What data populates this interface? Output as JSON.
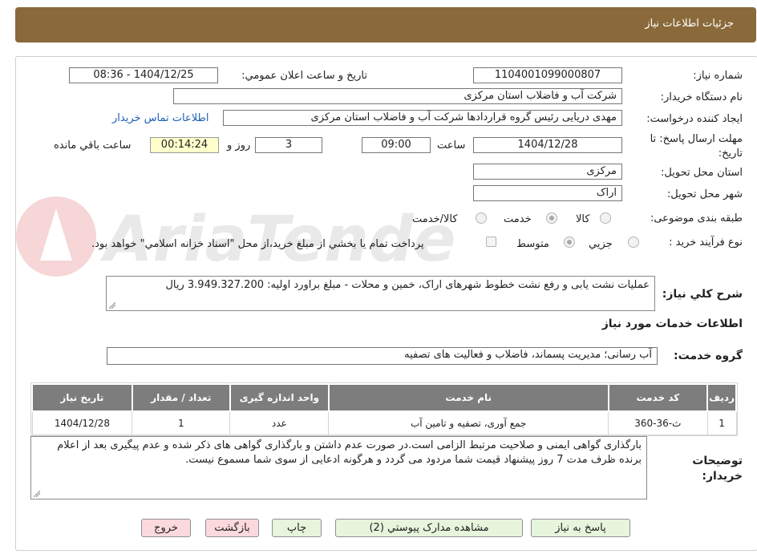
{
  "header": {
    "title": "جزئیات اطلاعات نیاز"
  },
  "form": {
    "need_number_label": "شماره نیاز:",
    "need_number": "1104001099000807",
    "announce_label": "تاریخ و ساعت اعلان عمومي:",
    "announce_value": "1404/12/25 - 08:36",
    "buyer_org_label": "نام دستگاه خريدار:",
    "buyer_org": "شرکت آب و فاضلاب استان مرکزی",
    "requester_label": "ايجاد کننده درخواست:",
    "requester": "مهدی دریایی رئیس گروه قراردادها شرکت آب و فاضلاب استان مرکزی",
    "contact_link": "اطلاعات تماس خريدار",
    "deadline_label": "مهلت ارسال پاسخ: تا تاريخ:",
    "deadline_date": "1404/12/28",
    "time_label": "ساعت",
    "deadline_time": "09:00",
    "days_value": "3",
    "days_label": "روز و",
    "remaining_time": "00:14:24",
    "remaining_label": "ساعت باقي مانده",
    "province_label": "استان محل تحويل:",
    "province": "مرکزی",
    "city_label": "شهر محل تحويل:",
    "city": "اراک",
    "category_label": "طبقه بندی موضوعی:",
    "category_options": [
      "کالا",
      "خدمت",
      "کالا/خدمت"
    ],
    "category_selected": "خدمت",
    "process_label": "نوع فرآيند خريد :",
    "process_options": [
      "جزيي",
      "متوسط"
    ],
    "process_selected": "متوسط",
    "payment_note": "پرداخت تمام يا بخشي از مبلغ خريد،از محل \"اسناد خزانه اسلامي\" خواهد بود.",
    "description_label": "شرح کلي نياز:",
    "description": "عملیات نشت یابی و رفع نشت خطوط شهرهای اراک، خمین و محلات - مبلغ براورد اولیه: 3.949.327.200 ریال"
  },
  "services": {
    "section_title": "اطلاعات خدمات مورد نياز",
    "group_label": "گروه خدمت:",
    "group_value": "آب رسانی؛ مديريت پسماند، فاضلاب و فعاليت هاى تصفيه",
    "columns": [
      "رديف",
      "کد خدمت",
      "نام خدمت",
      "واحد اندازه گيری",
      "تعداد / مقدار",
      "تاريخ نياز"
    ],
    "rows": [
      [
        "1",
        "ث-36-360",
        "جمع آوری، تصفيه و تامين آب",
        "عدد",
        "1",
        "1404/12/28"
      ]
    ]
  },
  "buyer_notes": {
    "label": "توضيحات خريدار:",
    "text": "بارگذاری گواهی ایمنی و صلاحیت مرتبط الزامی است.در صورت عدم داشتن و بارگذاری گواهی های ذکر شده و عدم پیگیری بعد از اعلام برنده ظرف مدت 7 روز پیشنهاد قیمت شما مردود می گردد و هرگونه ادعایی از سوی شما مسموع نیست."
  },
  "buttons": {
    "reply": "پاسخ به نياز",
    "attachments": "مشاهده مدارک پيوستي (2)",
    "print": "چاپ",
    "back": "بازگشت",
    "exit": "خروج"
  },
  "colors": {
    "header_bg": "#8a6a3a",
    "table_header_bg": "#7d7d7d",
    "button_green": "#e6f5dc",
    "button_pink": "#fbd9dc"
  }
}
